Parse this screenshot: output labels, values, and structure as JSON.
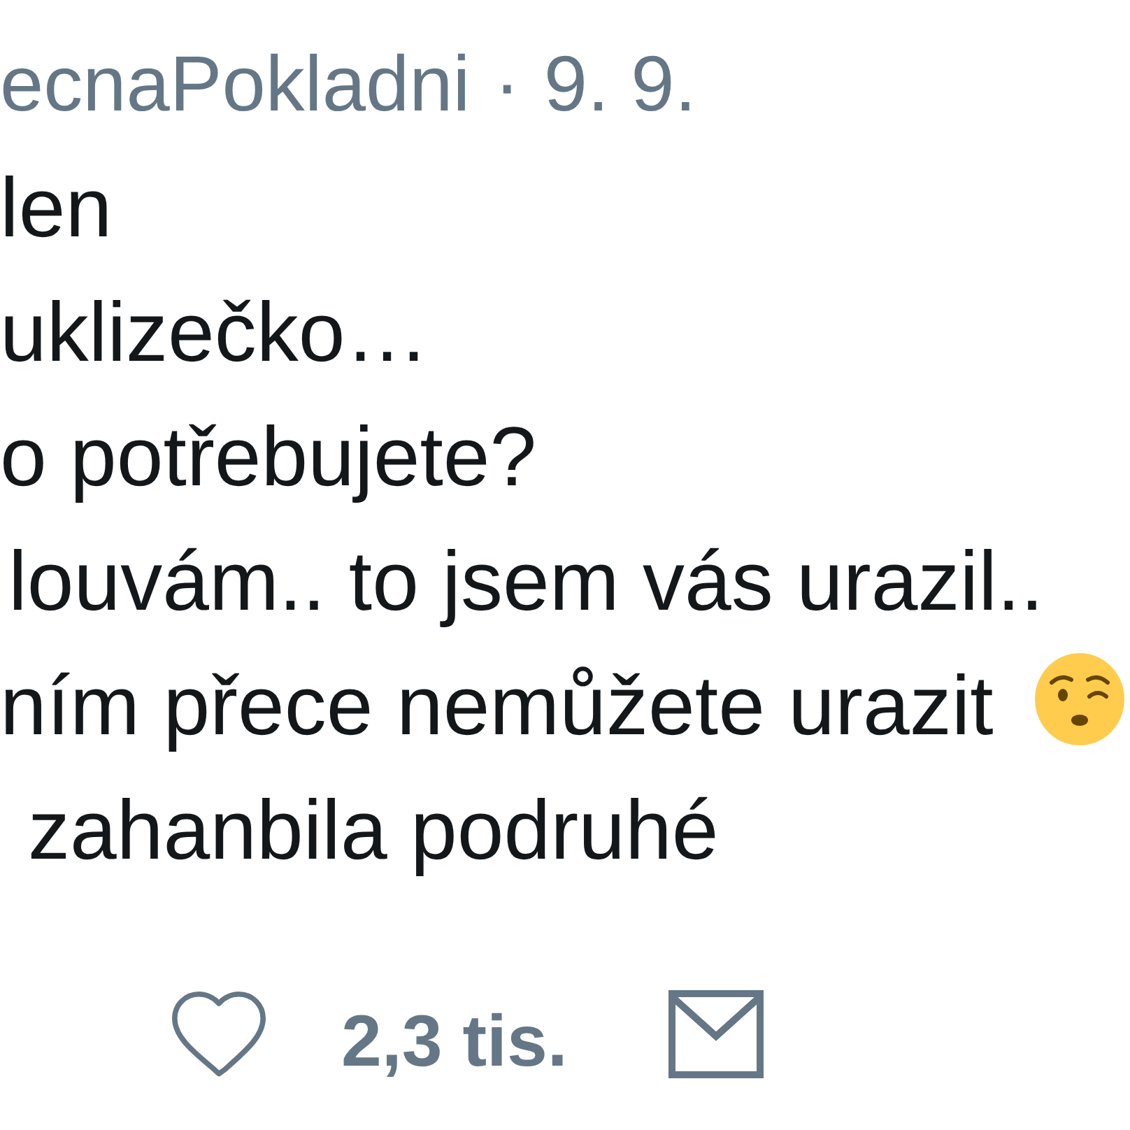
{
  "tweet": {
    "header": {
      "author": "ecnaPokladni",
      "separator": "·",
      "date": "9. 9."
    },
    "lines": [
      {
        "text": "len",
        "emoji": false
      },
      {
        "text": "uklizečko…",
        "emoji": false
      },
      {
        "text": "o potřebujete?",
        "emoji": false
      },
      {
        "text": "louvám.. to jsem vás urazil..",
        "emoji": false
      },
      {
        "text": "ním přece nemůžete urazit",
        "emoji": true
      },
      {
        "text": "zahanbila podruhé",
        "emoji": false
      }
    ],
    "actions": {
      "like_count": "2,3 tis."
    }
  }
}
